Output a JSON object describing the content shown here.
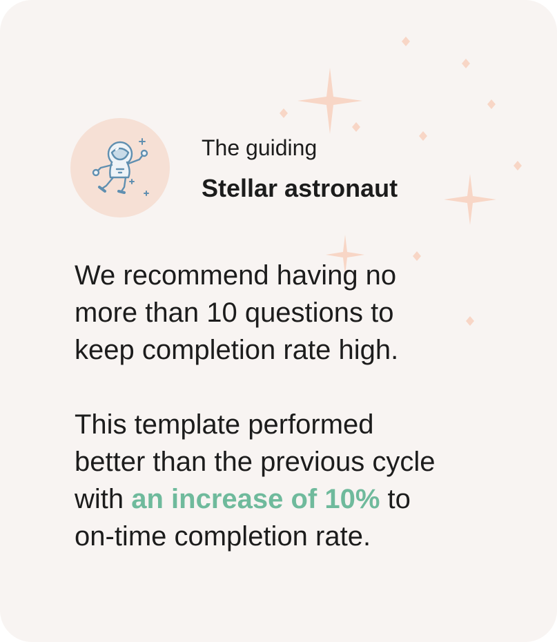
{
  "insight_card": {
    "icon": "astronaut-icon",
    "role_subtitle": "The guiding",
    "role_title": "Stellar astronaut",
    "recommendation_lines": [
      "We recommend having no",
      "more than 10 questions to",
      "keep completion rate high."
    ],
    "performance": {
      "line_1": "This template performed",
      "line_2": "better than the previous cycle",
      "line_3_prefix": "with ",
      "highlight": "an increase of 10%",
      "line_3_suffix": " to",
      "line_4": "on-time completion rate."
    }
  },
  "colors": {
    "card_background": "#f8f4f2",
    "avatar_background": "#f6e0d5",
    "sparkle": "#f6d3c4",
    "highlight": "#6fba9c",
    "text": "#1c1c1c",
    "astronaut_stroke": "#5f8fb0"
  }
}
